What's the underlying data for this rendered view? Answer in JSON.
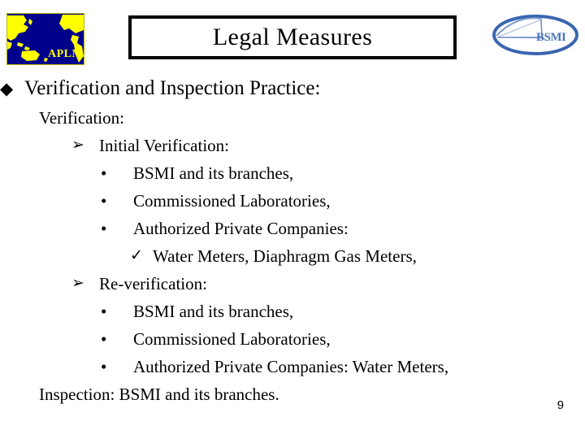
{
  "header": {
    "title": "Legal Measures",
    "left_logo": {
      "name": "aplmf-logo",
      "caption": "APLMF",
      "map_color": "#FFFF00",
      "sea_color": "#00008B"
    },
    "right_logo": {
      "name": "bsmi-logo",
      "caption": "BSMI",
      "ring_color": "#3A66B0"
    }
  },
  "content": {
    "main_bullet": {
      "glyph": "diamond-bullet-icon",
      "symbol": "◆",
      "text": "Verification and Inspection Practice:"
    },
    "sections": [
      {
        "label": "Verification:",
        "groups": [
          {
            "glyph": "arrow-bullet-icon",
            "symbol": "➢",
            "label": "Initial Verification:",
            "items": [
              {
                "glyph": "dot-bullet-icon",
                "symbol": "•",
                "text": "BSMI and its branches,",
                "subitems": []
              },
              {
                "glyph": "dot-bullet-icon",
                "symbol": "•",
                "text": "Commissioned Laboratories,",
                "subitems": []
              },
              {
                "glyph": "dot-bullet-icon",
                "symbol": "•",
                "text": "Authorized  Private Companies:",
                "subitems": [
                  {
                    "glyph": "check-bullet-icon",
                    "symbol": "✓",
                    "text": "Water Meters, Diaphragm Gas Meters,"
                  }
                ]
              }
            ]
          },
          {
            "glyph": "arrow-bullet-icon",
            "symbol": "➢",
            "label": "Re-verification:",
            "items": [
              {
                "glyph": "dot-bullet-icon",
                "symbol": "•",
                "text": "BSMI and its branches,",
                "subitems": []
              },
              {
                "glyph": "dot-bullet-icon",
                "symbol": "•",
                "text": "Commissioned Laboratories,",
                "subitems": []
              },
              {
                "glyph": "dot-bullet-icon",
                "symbol": "•",
                "text": "Authorized  Private Companies: Water Meters,",
                "subitems": []
              }
            ]
          }
        ]
      }
    ],
    "closing_line": "Inspection: BSMI and its branches."
  },
  "footer": {
    "page_number": "9"
  }
}
